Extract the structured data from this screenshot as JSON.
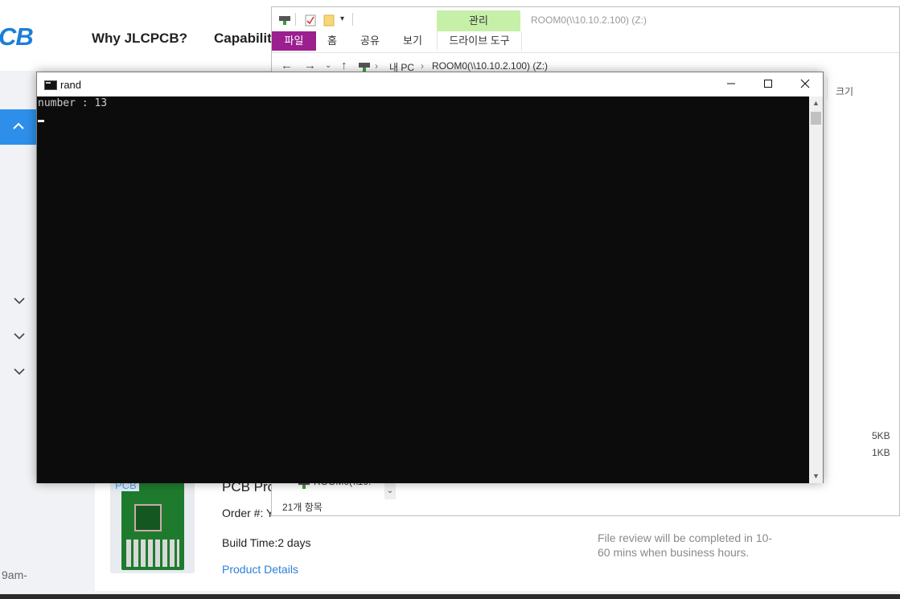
{
  "website": {
    "logo": "CB",
    "nav": [
      "Why JLCPCB?",
      "Capabiliti"
    ],
    "time_fragment": "9am-",
    "card": {
      "badge": "PCB",
      "product_title": "PCB Pro",
      "order_label": "Order #: Y",
      "build_time": "Build Time:2 days",
      "details_link": "Product Details",
      "review_note": "File review will be completed in 10-60 mins when business hours."
    }
  },
  "explorer": {
    "window_title": "ROOM0(\\\\10.10.2.100) (Z:)",
    "manage_tab": "관리",
    "ribbon_tabs": [
      "파일",
      "홈",
      "공유",
      "보기"
    ],
    "drive_tools_tab": "드라이브 도구",
    "address": {
      "pc": "내 PC",
      "location": "ROOM0(\\\\10.10.2.100) (Z:)"
    },
    "column_size": "크기",
    "file_sizes": [
      "5KB",
      "1KB"
    ],
    "nav_item": "ROOM0(\\\\10.",
    "status": "21개 항목"
  },
  "console": {
    "title": "rand",
    "output": "number : 13",
    "icon": "console-icon"
  },
  "colors": {
    "accent_blue": "#2d8fea",
    "file_tab": "#9b1f8f",
    "manage_tab": "#c6efa8",
    "console_bg": "#0c0c0c"
  }
}
